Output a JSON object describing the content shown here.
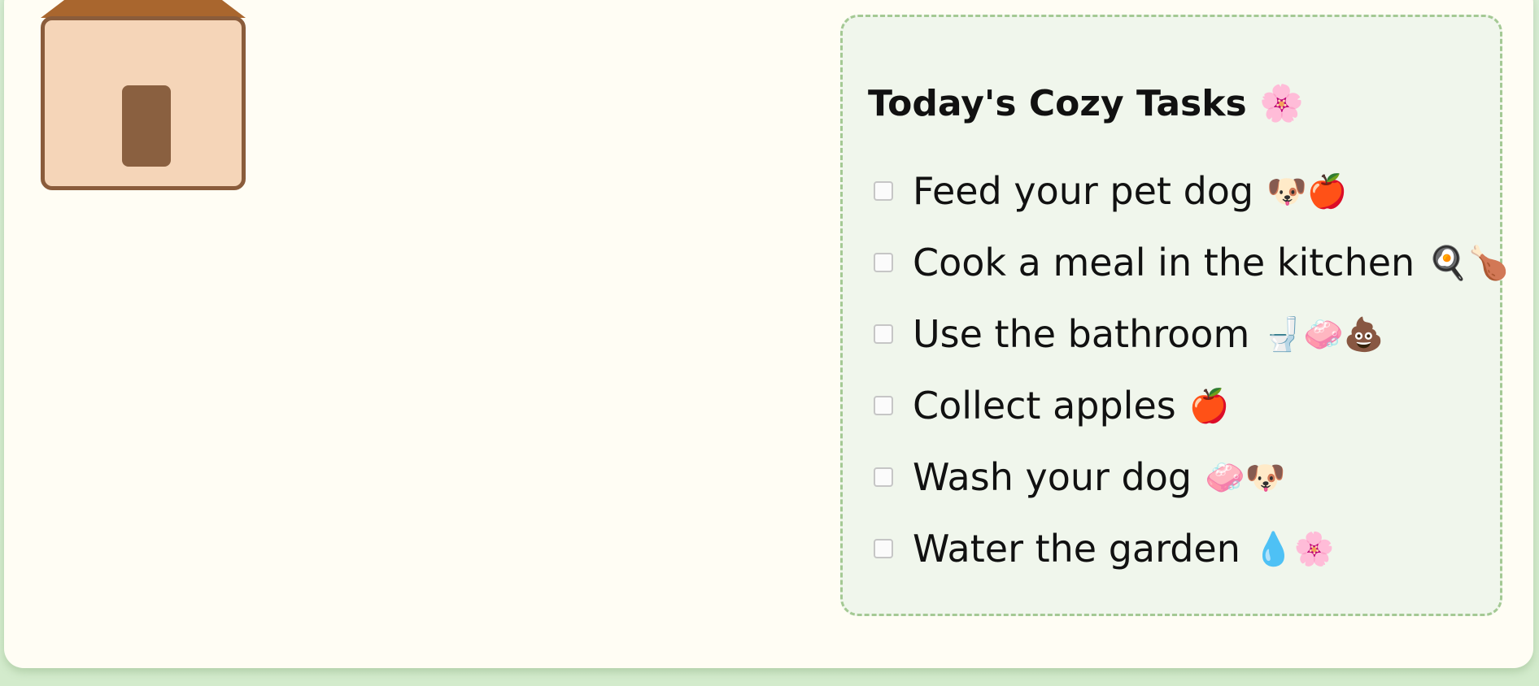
{
  "colors": {
    "background": "#d7ecd2",
    "card": "#fffdf4",
    "panel": "#f0f6ec",
    "panel_border": "#a4c994",
    "roof": "#a9662e",
    "house_wall": "#f5d5b8",
    "house_outline": "#8a5c3b",
    "door": "#8a6040"
  },
  "house": {
    "icon": "house-icon"
  },
  "tasks": {
    "title": "Today's Cozy Tasks 🌸",
    "items": [
      {
        "label": "Feed your pet dog",
        "emoji": "🐶🍎",
        "checked": false
      },
      {
        "label": "Cook a meal in the kitchen",
        "emoji": "🍳🍗",
        "checked": false
      },
      {
        "label": "Use the bathroom",
        "emoji": "🚽🧼💩",
        "checked": false
      },
      {
        "label": "Collect apples",
        "emoji": "🍎",
        "checked": false
      },
      {
        "label": "Wash your dog",
        "emoji": "🧼🐶",
        "checked": false
      },
      {
        "label": "Water the garden",
        "emoji": "💧🌸",
        "checked": false
      }
    ]
  }
}
